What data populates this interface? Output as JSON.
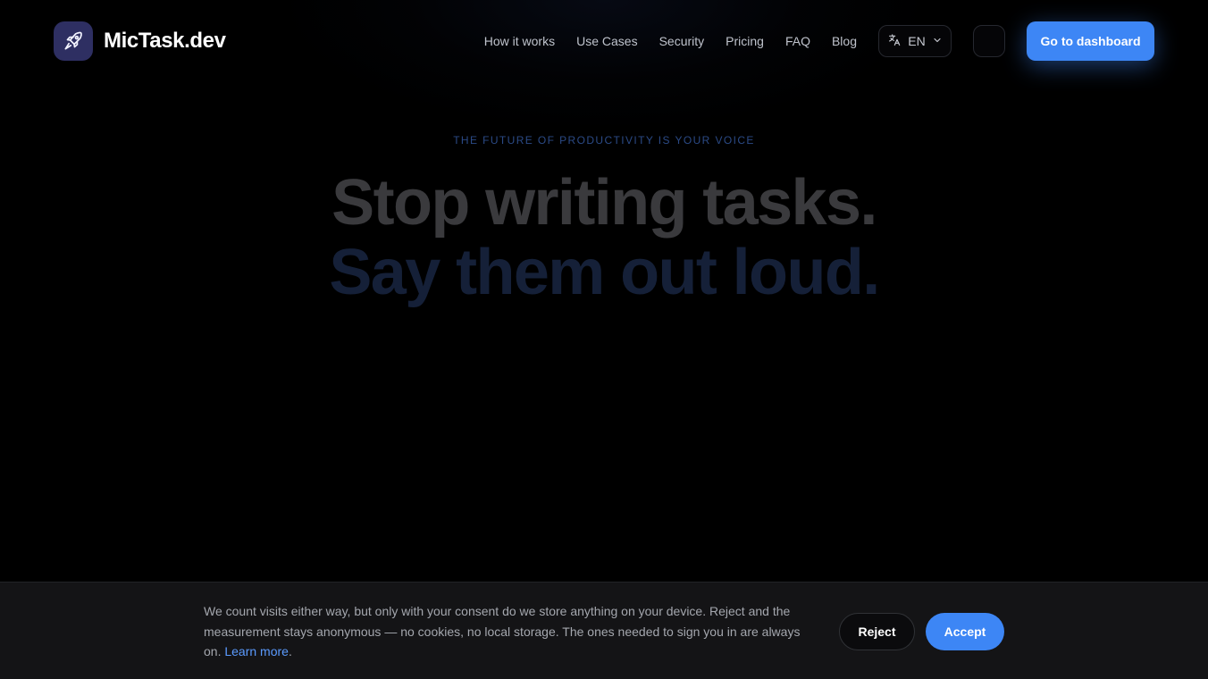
{
  "header": {
    "brand_name": "MicTask.dev",
    "logo_icon": "rocket-icon",
    "nav": [
      {
        "label": "How it works"
      },
      {
        "label": "Use Cases"
      },
      {
        "label": "Security"
      },
      {
        "label": "Pricing"
      },
      {
        "label": "FAQ"
      },
      {
        "label": "Blog"
      }
    ],
    "language": {
      "icon": "translate-icon",
      "label": "EN",
      "chevron": "chevron-down-icon"
    },
    "cta_label": "Go to dashboard"
  },
  "hero": {
    "eyebrow": "THE FUTURE OF PRODUCTIVITY IS YOUR VOICE",
    "headline_line1": "Stop writing tasks.",
    "headline_line2": "Say them out loud."
  },
  "cookie_banner": {
    "text": "We count visits either way, but only with your consent do we store anything on your device. Reject and the measurement stays anonymous — no cookies, no local storage. The ones needed to sign you in are always on.",
    "learn_more": "Learn more",
    "trailing": ".",
    "reject_label": "Reject",
    "accept_label": "Accept"
  },
  "colors": {
    "accent": "#3d86f5",
    "background": "#000000",
    "banner_background": "#141416",
    "link": "#5b9bff"
  }
}
